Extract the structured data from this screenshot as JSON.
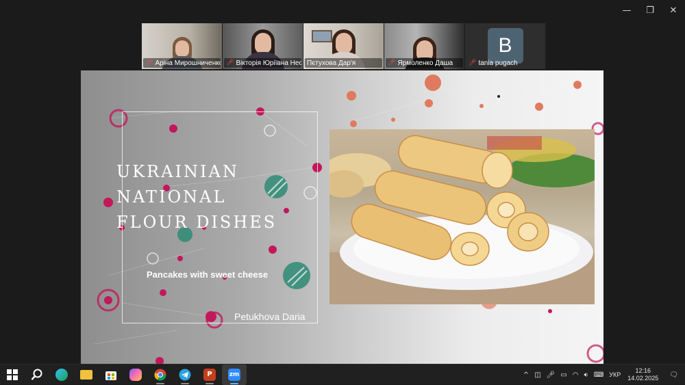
{
  "window": {
    "controls": {
      "minimize": "—",
      "restore": "❐",
      "close": "✕"
    }
  },
  "participants": [
    {
      "name": "Аріна Мирошниченко",
      "muted": true,
      "video": true,
      "active": false
    },
    {
      "name": "Вікторія Юріївна Несте...",
      "muted": true,
      "video": true,
      "active": false
    },
    {
      "name": "Пєтухова Дар'я",
      "muted": false,
      "video": true,
      "active": true
    },
    {
      "name": "Ярмоленко Даша",
      "muted": true,
      "video": true,
      "active": false
    },
    {
      "name": "tania pugach",
      "muted": true,
      "video": false,
      "avatar_letter": "B",
      "active": false
    }
  ],
  "slide": {
    "title_lines": [
      "UKRAINIAN",
      "NATIONAL",
      "FLOUR DISHES"
    ],
    "subtitle": "Pancakes  with sweet cheese",
    "author": "Petukhova Daria"
  },
  "taskbar": {
    "apps": [
      {
        "name": "start",
        "icon": "windows-icon"
      },
      {
        "name": "search",
        "icon": "search-icon"
      },
      {
        "name": "edge",
        "icon": "edge-icon"
      },
      {
        "name": "file-explorer",
        "icon": "folder-icon"
      },
      {
        "name": "store",
        "icon": "store-icon"
      },
      {
        "name": "copilot",
        "icon": "copilot-icon"
      },
      {
        "name": "chrome",
        "icon": "chrome-icon"
      },
      {
        "name": "telegram",
        "icon": "telegram-icon"
      },
      {
        "name": "powerpoint",
        "icon": "powerpoint-icon"
      },
      {
        "name": "zoom",
        "icon": "zoom-icon",
        "label": "zm"
      }
    ],
    "tray": {
      "chevron": "^",
      "language": "УКР",
      "time": "12:16",
      "date": "14.02.2025"
    }
  },
  "colors": {
    "active_speaker": "#3fd16a",
    "taskbar": "#202020",
    "zoom_blue": "#2d8cff",
    "powerpoint_red": "#c43e1c"
  }
}
